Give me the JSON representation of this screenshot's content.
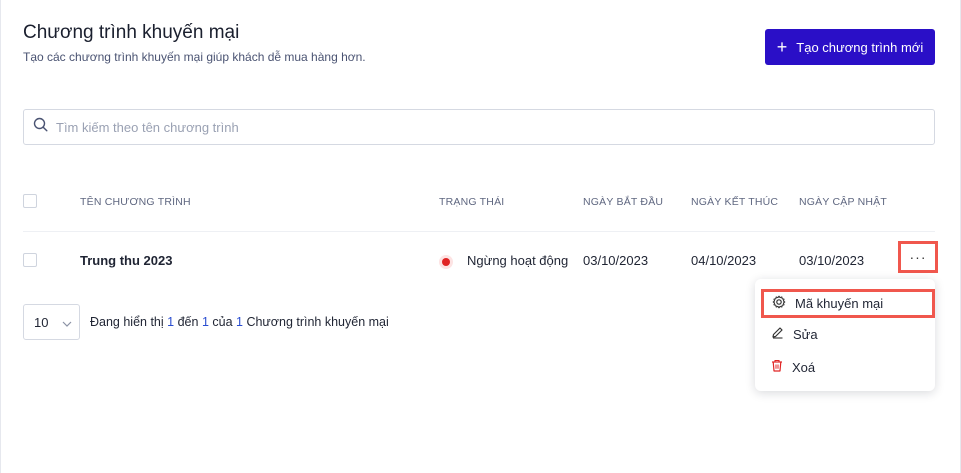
{
  "header": {
    "title": "Chương trình khuyến mại",
    "subtitle": "Tạo các chương trình khuyến mại giúp khách dễ mua hàng hơn.",
    "create_button_label": "Tạo chương trình mới"
  },
  "search": {
    "placeholder": "Tìm kiếm theo tên chương trình",
    "value": ""
  },
  "table": {
    "columns": [
      "TÊN CHƯƠNG TRÌNH",
      "TRẠNG THÁI",
      "NGÀY BẮT ĐẦU",
      "NGÀY KẾT THÚC",
      "NGÀY CẬP NHẬT"
    ],
    "rows": [
      {
        "name": "Trung thu 2023",
        "status": "Ngừng hoạt động",
        "status_color": "#e02424",
        "start_date": "03/10/2023",
        "end_date": "04/10/2023",
        "updated_date": "03/10/2023",
        "more_label": "···"
      }
    ]
  },
  "pagination": {
    "page_size": "10",
    "showing_prefix": "Đang hiển thị",
    "from": "1",
    "to_word": "đến",
    "to": "1",
    "of_word": "của",
    "total": "1",
    "suffix": "Chương trình khuyến mại"
  },
  "context_menu": {
    "items": [
      {
        "label": "Mã khuyến mại",
        "icon": "gear-icon"
      },
      {
        "label": "Sửa",
        "icon": "pencil-icon"
      },
      {
        "label": "Xoá",
        "icon": "trash-icon"
      }
    ]
  },
  "colors": {
    "primary": "#2a0fc7",
    "highlight_border": "#f0574d",
    "status_inactive": "#e02424",
    "delete_icon": "#e02424"
  }
}
